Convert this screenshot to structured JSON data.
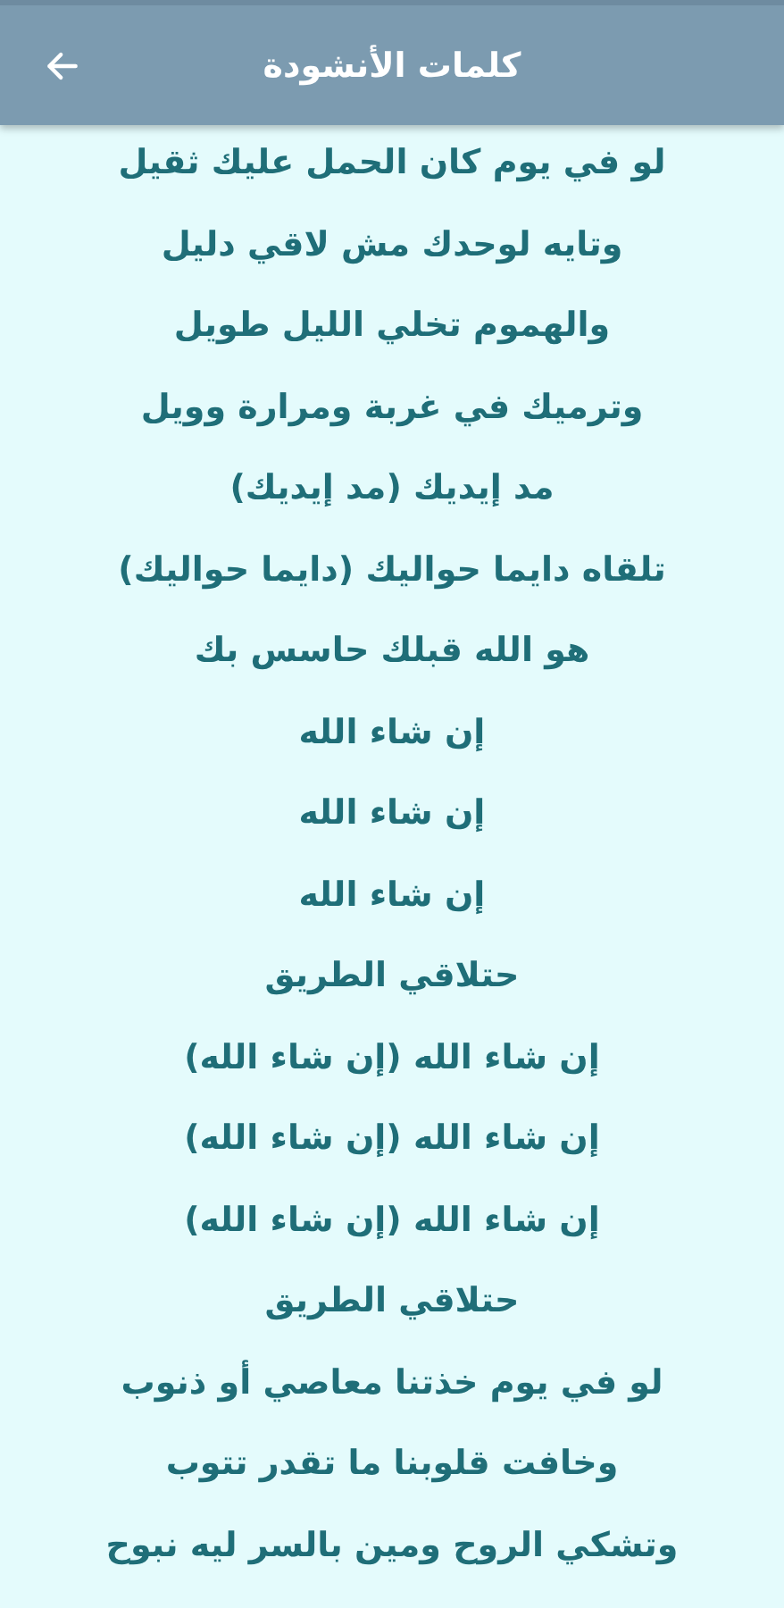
{
  "header": {
    "title": "كلمات الأنشودة"
  },
  "lyrics": [
    "لو في يوم كان الحمل عليك ثقيل",
    "وتايه لوحدك مش لاقي دليل",
    "والهموم تخلي الليل طويل",
    "وترميك في غربة ومرارة وويل",
    "مد إيديك (مد إيديك)",
    "تلقاه دايما حواليك (دايما حواليك)",
    "هو الله قبلك حاسس بك",
    "إن شاء الله",
    "إن شاء الله",
    "إن شاء الله",
    "حتلاقي الطريق",
    "إن شاء الله (إن شاء الله)",
    "إن شاء الله (إن شاء الله)",
    "إن شاء الله (إن شاء الله)",
    "حتلاقي الطريق",
    "لو في يوم خذتنا معاصي أو ذنوب",
    "وخافت قلوبنا ما تقدر تتوب",
    "وتشكي الروح ومين بالسر ليه نبوح"
  ]
}
